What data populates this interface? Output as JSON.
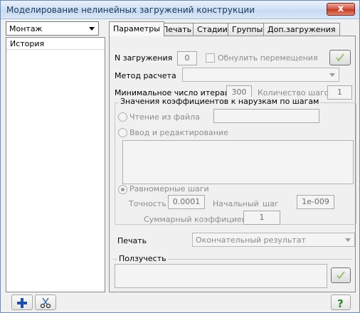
{
  "window": {
    "title": "Моделирование нелинейных загружений конструкции",
    "close_glyph": "x"
  },
  "mode_select": {
    "value": "Монтаж"
  },
  "history": {
    "label": "История"
  },
  "tabs": [
    {
      "label": "Параметры",
      "active": true
    },
    {
      "label": "Печать",
      "active": false
    },
    {
      "label": "Стадии",
      "active": false
    },
    {
      "label": "Группы",
      "active": false
    },
    {
      "label": "Доп.загружения",
      "active": false
    }
  ],
  "params": {
    "load_number_label": "N загружения",
    "load_number_value": "0",
    "reset_displacements_label": "Обнулить перемещения",
    "calc_method_label": "Метод расчета",
    "calc_method_value": "",
    "min_iterations_label": "Минимальное число итераций",
    "min_iterations_value": "300",
    "steps_count_label": "Количество шагов",
    "steps_count_value": "1",
    "coef_group_title": "Значения коэффициентов к нарузкам по шагам",
    "read_from_file_label": "Чтение из файла",
    "read_from_file_value": "",
    "input_edit_label": "Ввод и редактирование",
    "uniform_steps_label": "Равномерные шаги",
    "accuracy_label": "Точность",
    "accuracy_value": "0.0001",
    "initial_step_label": "Начальный",
    "initial_step_label2": "шаг",
    "initial_step_value": "1e-009",
    "total_coef_label": "Суммарный коэффициент",
    "total_coef_value": "1",
    "print_label": "Печать",
    "print_value": "Окончательный результат",
    "creep_title": "Ползучесть"
  },
  "colors": {
    "accent_check": "#6fa23a",
    "plus": "#1f4ea8",
    "help": "#2e7d2e"
  }
}
